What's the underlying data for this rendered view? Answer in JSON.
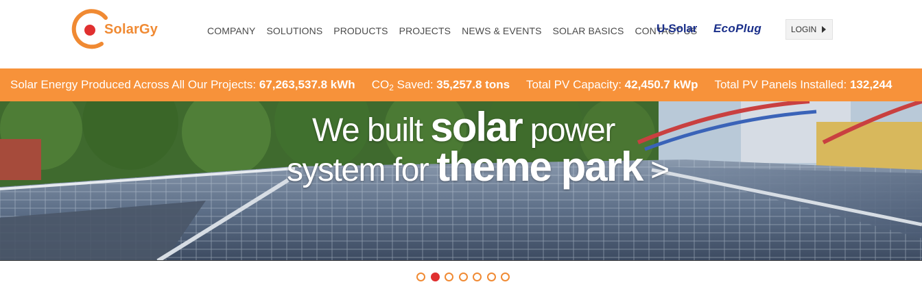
{
  "header": {
    "logo_text": "SolarGy",
    "nav": [
      {
        "label": "COMPANY"
      },
      {
        "label": "SOLUTIONS"
      },
      {
        "label": "PRODUCTS"
      },
      {
        "label": "PROJECTS"
      },
      {
        "label": "NEWS & EVENTS"
      },
      {
        "label": "SOLAR BASICS"
      },
      {
        "label": "CONTACT US"
      }
    ],
    "brands": {
      "usolar": "U-Solar",
      "ecoplug": "EcoPlug"
    },
    "login_label": "LOGIN"
  },
  "stats": [
    {
      "label": "Solar Energy Produced Across All Our Projects: ",
      "value": "67,263,537.8 kWh"
    },
    {
      "label_pre": "CO",
      "label_sub": "2",
      "label_post": " Saved: ",
      "value": "35,257.8 tons"
    },
    {
      "label": "Total PV Capacity: ",
      "value": "42,450.7 kWp"
    },
    {
      "label": "Total PV Panels Installed: ",
      "value": "132,244"
    }
  ],
  "hero": {
    "line1_pre": "We built ",
    "line1_big": "solar",
    "line1_post": " power",
    "line2_pre": "system for ",
    "line2_big": "theme park",
    "line2_arrow": " >"
  },
  "carousel": {
    "slide_count": 7,
    "active_index": 1
  },
  "colors": {
    "accent_orange": "#f7923a",
    "brand_blue": "#1a2f8a",
    "dot_active": "#e03030"
  }
}
